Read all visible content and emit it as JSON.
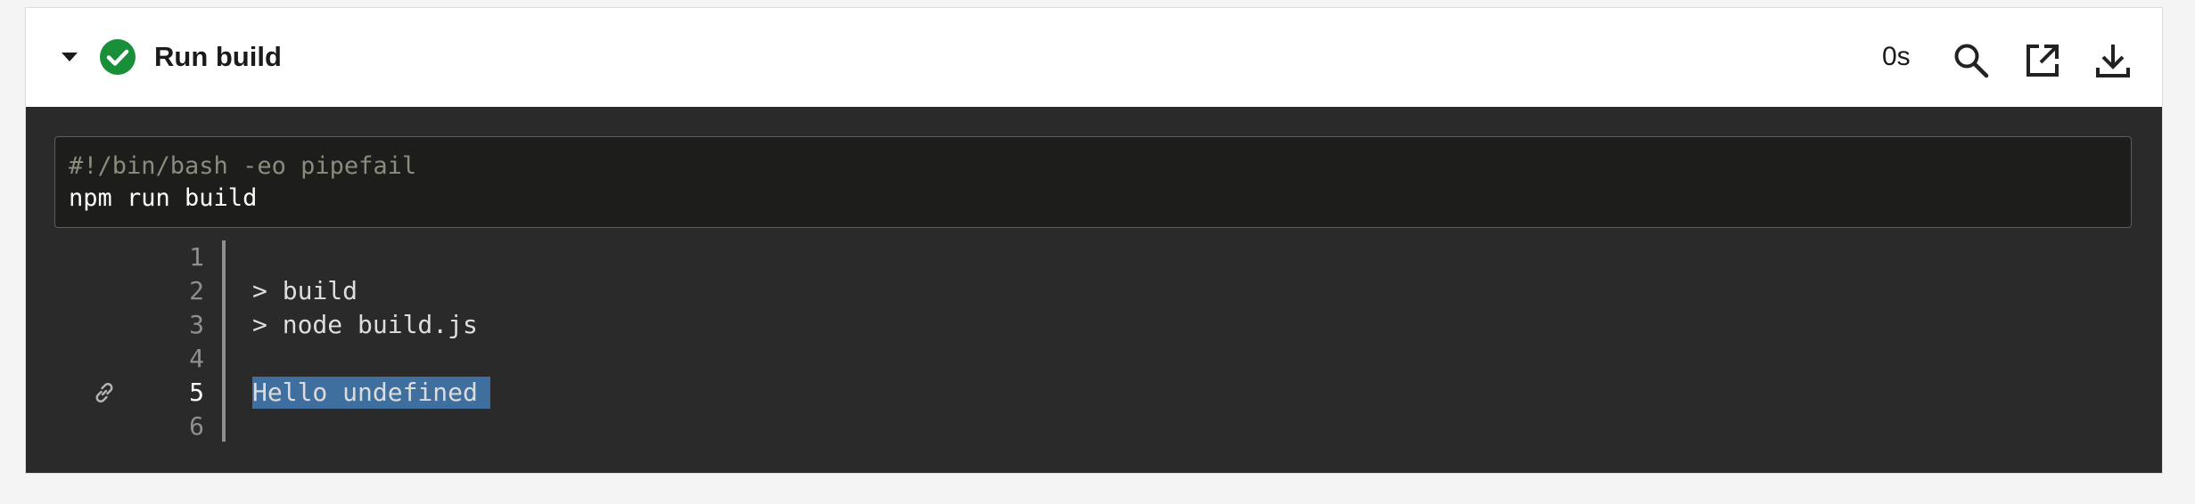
{
  "step": {
    "title": "Run build",
    "duration": "0s",
    "status": "success",
    "status_color": "#1a8f3a",
    "icons": {
      "toggle": "caret-down-icon",
      "status": "check-circle-icon",
      "search": "search-icon",
      "open": "open-external-icon",
      "download": "download-icon"
    }
  },
  "script": {
    "comment": "#!/bin/bash -eo pipefail",
    "command": "npm run build"
  },
  "log": {
    "lines": [
      {
        "number": "1",
        "text": ""
      },
      {
        "number": "2",
        "text": "> build"
      },
      {
        "number": "3",
        "text": "> node build.js"
      },
      {
        "number": "4",
        "text": ""
      },
      {
        "number": "5",
        "text": "Hello undefined"
      },
      {
        "number": "6",
        "text": ""
      }
    ],
    "highlight_color": "#3f6f9f",
    "link_icon": "link-icon"
  }
}
